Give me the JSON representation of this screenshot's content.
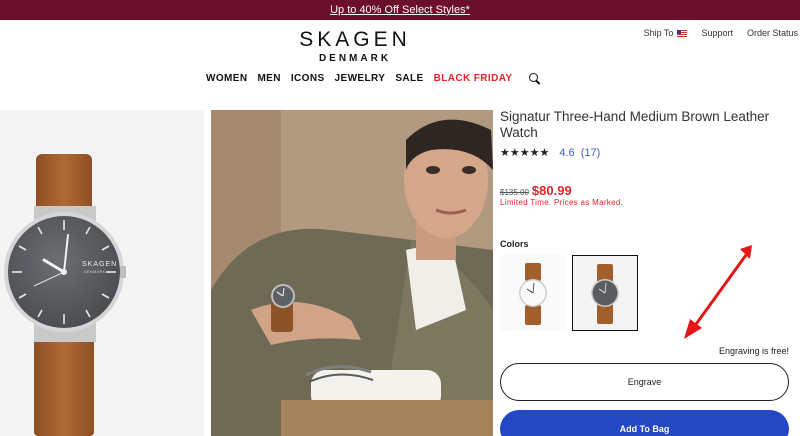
{
  "promo": {
    "text": "Up to 40% Off Select Styles*"
  },
  "utility": {
    "ship_to": "Ship To",
    "support": "Support",
    "order_status": "Order Status"
  },
  "brand": {
    "name": "SKAGEN",
    "sub": "DENMARK"
  },
  "nav": {
    "items": [
      "WOMEN",
      "MEN",
      "ICONS",
      "JEWELRY",
      "SALE",
      "BLACK FRIDAY"
    ],
    "highlight_color": "#e2252b"
  },
  "product": {
    "title": "Signatur Three-Hand Medium Brown Leather Watch",
    "stars": "★★★★★",
    "rating": "4.6",
    "review_count": "(17)",
    "old_price": "$135.00",
    "new_price": "$80.99",
    "price_note": "Limited Time. Prices as Marked.",
    "dial_brand": "SKAGEN",
    "dial_sub": "DENMARK"
  },
  "colors": {
    "label": "Colors",
    "options": [
      "white-dial-brown-strap",
      "gray-dial-brown-strap"
    ],
    "selected": 1
  },
  "actions": {
    "engrave_note": "Engraving is free!",
    "engrave_label": "Engrave",
    "add_to_bag_label": "Add To Bag"
  },
  "theme": {
    "promo_bg": "#6b0f2a",
    "primary": "#2447c4",
    "sale": "#e2252b"
  }
}
